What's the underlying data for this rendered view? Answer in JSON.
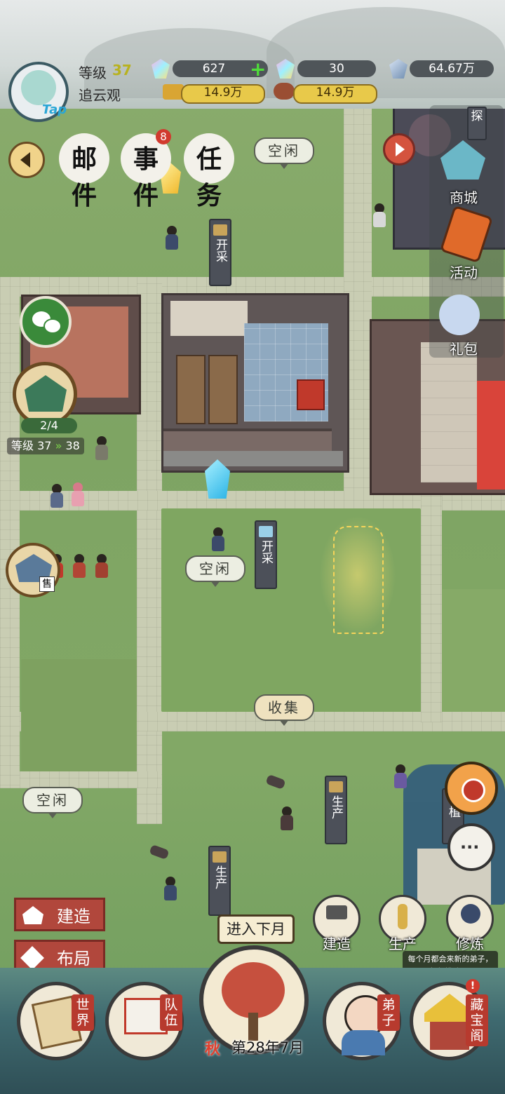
{
  "player": {
    "level_label": "等级",
    "level_value": "37",
    "sect_name": "追云观",
    "avatar_badge": "Tap"
  },
  "resources": {
    "spirit_stone": "627",
    "spirit_stone_alt": "30",
    "crystal": "64.67万",
    "gold": "14.9万",
    "wood": "14.9万"
  },
  "top_menu": {
    "mail": "邮件",
    "event": "事件",
    "event_badge": "8",
    "task": "任务"
  },
  "right_menu": {
    "shop": "商城",
    "activity": "活动",
    "gift": "礼包",
    "explore": "探"
  },
  "map": {
    "bubble_idle_1": "空闲",
    "bubble_idle_2": "空闲",
    "bubble_idle_3": "空闲",
    "bubble_collect": "收集",
    "tag_mine_1": "开采",
    "tag_mine_2": "开采",
    "tag_produce_1": "生产",
    "tag_produce_2": "生产",
    "tag_plant": "种植"
  },
  "left_panel": {
    "hall_progress": "2/4",
    "level_up_label": "等级",
    "level_from": "37",
    "level_to": "38",
    "sell_label": "售"
  },
  "actions": {
    "build": "建造",
    "layout": "布局",
    "next_month": "进入下月",
    "season": "秋",
    "date": "第28年7月",
    "circle_build": "建造",
    "circle_produce": "生产",
    "circle_cultivate": "修炼",
    "tip": "每个月都会来新的弟子，细细挑选吧!"
  },
  "bottom_nav": {
    "world": "世界",
    "team": "队伍",
    "disciples": "弟子",
    "treasury": "藏宝阁"
  },
  "colors": {
    "grass": "#82a866",
    "path": "#c9cdb3",
    "accent_red": "#b1473c",
    "gold": "#e8c94a"
  }
}
